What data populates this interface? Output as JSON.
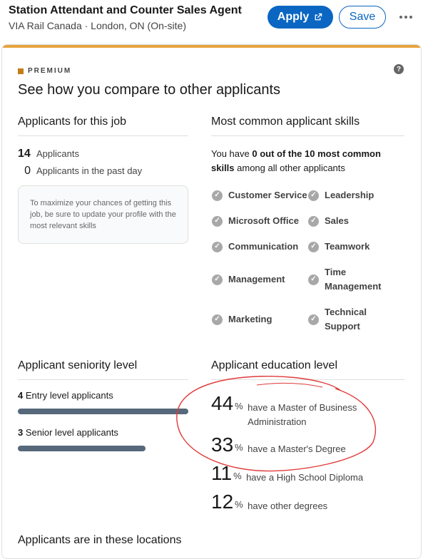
{
  "job": {
    "title": "Station Attendant and Counter Sales Agent",
    "subtitle": "VIA Rail Canada · London, ON (On-site)"
  },
  "actions": {
    "apply_label": "Apply",
    "save_label": "Save"
  },
  "premium": {
    "badge": "PREMIUM",
    "title": "See how you compare to other applicants"
  },
  "applicants": {
    "heading": "Applicants for this job",
    "total_count": "14",
    "total_label": "Applicants",
    "recent_count": "0",
    "recent_label": "Applicants in the past day",
    "tip": "To maximize your chances of getting this job, be sure to update your profile with the most relevant skills"
  },
  "skills": {
    "heading": "Most common applicant skills",
    "summary_pre": "You have ",
    "summary_bold": "0 out of the 10 most common skills",
    "summary_post": " among all other applicants",
    "items": [
      {
        "label": "Customer Service"
      },
      {
        "label": "Leadership"
      },
      {
        "label": "Microsoft Office"
      },
      {
        "label": "Sales"
      },
      {
        "label": "Communication"
      },
      {
        "label": "Teamwork"
      },
      {
        "label": "Management"
      },
      {
        "label": "Time Management"
      },
      {
        "label": "Marketing"
      },
      {
        "label": "Technical Support"
      }
    ]
  },
  "seniority": {
    "heading": "Applicant seniority level",
    "levels": [
      {
        "count": "4",
        "label": "Entry level applicants",
        "fraction": 1.0
      },
      {
        "count": "3",
        "label": "Senior level applicants",
        "fraction": 0.75
      }
    ]
  },
  "education": {
    "heading": "Applicant education level",
    "unit": "%",
    "items": [
      {
        "percent": "44",
        "label": "have a Master of Business Administration"
      },
      {
        "percent": "33",
        "label": "have a Master's Degree"
      },
      {
        "percent": "11",
        "label": "have a High School Diploma"
      },
      {
        "percent": "12",
        "label": "have other degrees"
      }
    ]
  },
  "locations": {
    "heading": "Applicants are in these locations"
  },
  "colors": {
    "brand": "#0a66c2",
    "premium_accent": "#e7a33e",
    "bar": "#56687a",
    "annotation": "#e03a3a"
  }
}
